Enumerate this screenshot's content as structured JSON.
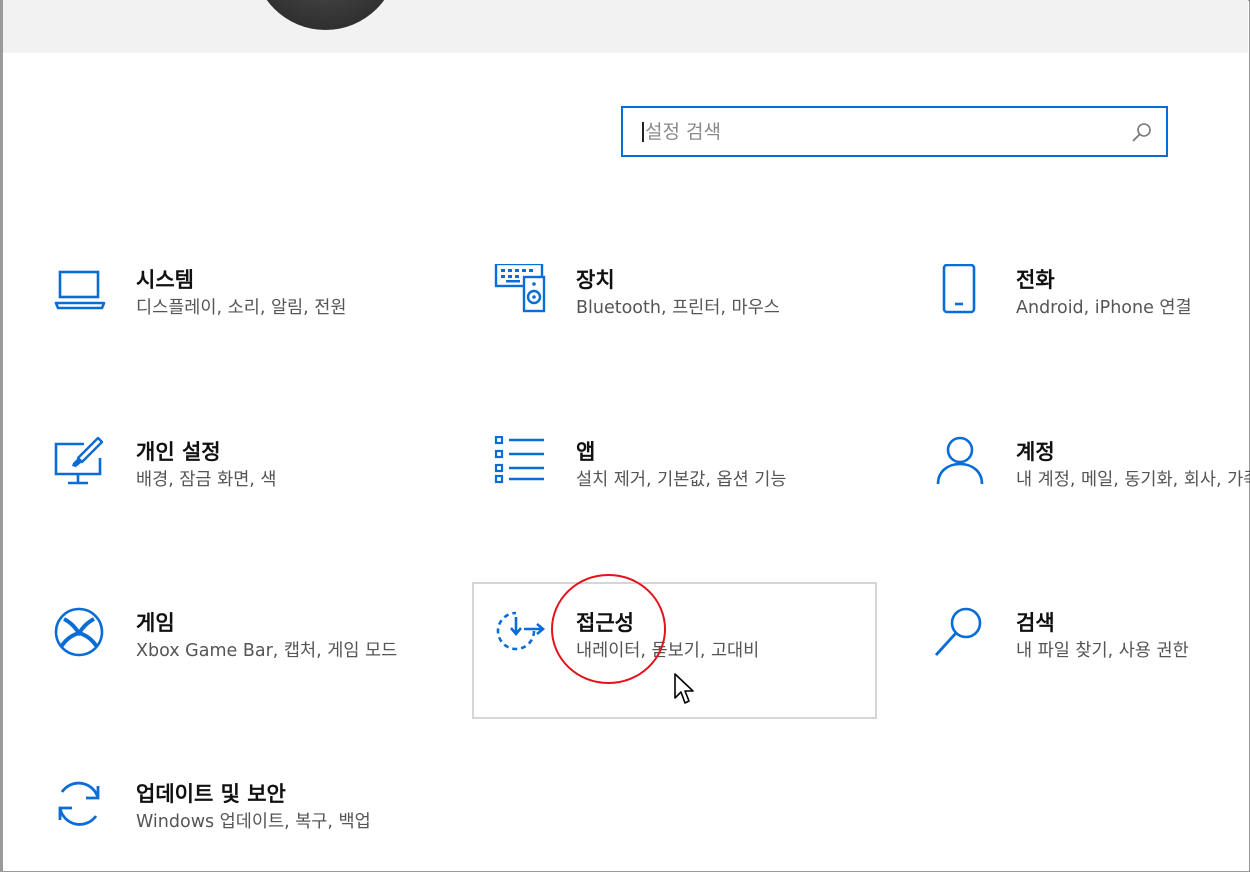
{
  "search": {
    "placeholder": "설정 검색"
  },
  "tiles": [
    {
      "id": "system",
      "title": "시스템",
      "desc": "디스플레이, 소리, 알림, 전원",
      "icon": "laptop-icon"
    },
    {
      "id": "devices",
      "title": "장치",
      "desc": "Bluetooth, 프린터, 마우스",
      "icon": "keyboard-speaker-icon"
    },
    {
      "id": "phone",
      "title": "전화",
      "desc": "Android, iPhone 연결",
      "icon": "phone-icon"
    },
    {
      "id": "personalization",
      "title": "개인 설정",
      "desc": "배경, 잠금 화면, 색",
      "icon": "paintbrush-monitor-icon"
    },
    {
      "id": "apps",
      "title": "앱",
      "desc": "설치 제거, 기본값, 옵션 기능",
      "icon": "apps-list-icon"
    },
    {
      "id": "accounts",
      "title": "계정",
      "desc": "내 계정, 메일, 동기화, 회사, 가족",
      "icon": "person-icon"
    },
    {
      "id": "gaming",
      "title": "게임",
      "desc": "Xbox Game Bar, 캡처, 게임 모드",
      "icon": "xbox-icon"
    },
    {
      "id": "accessibility",
      "title": "접근성",
      "desc": "내레이터, 돋보기, 고대비",
      "icon": "ease-of-access-icon"
    },
    {
      "id": "search",
      "title": "검색",
      "desc": "내 파일 찾기, 사용 권한",
      "icon": "magnifier-icon"
    },
    {
      "id": "update",
      "title": "업데이트 및 보안",
      "desc": "Windows 업데이트, 복구, 백업",
      "icon": "sync-arrows-icon"
    }
  ],
  "colors": {
    "accent": "#0a6cd6",
    "highlight_circle": "#e3121b"
  }
}
